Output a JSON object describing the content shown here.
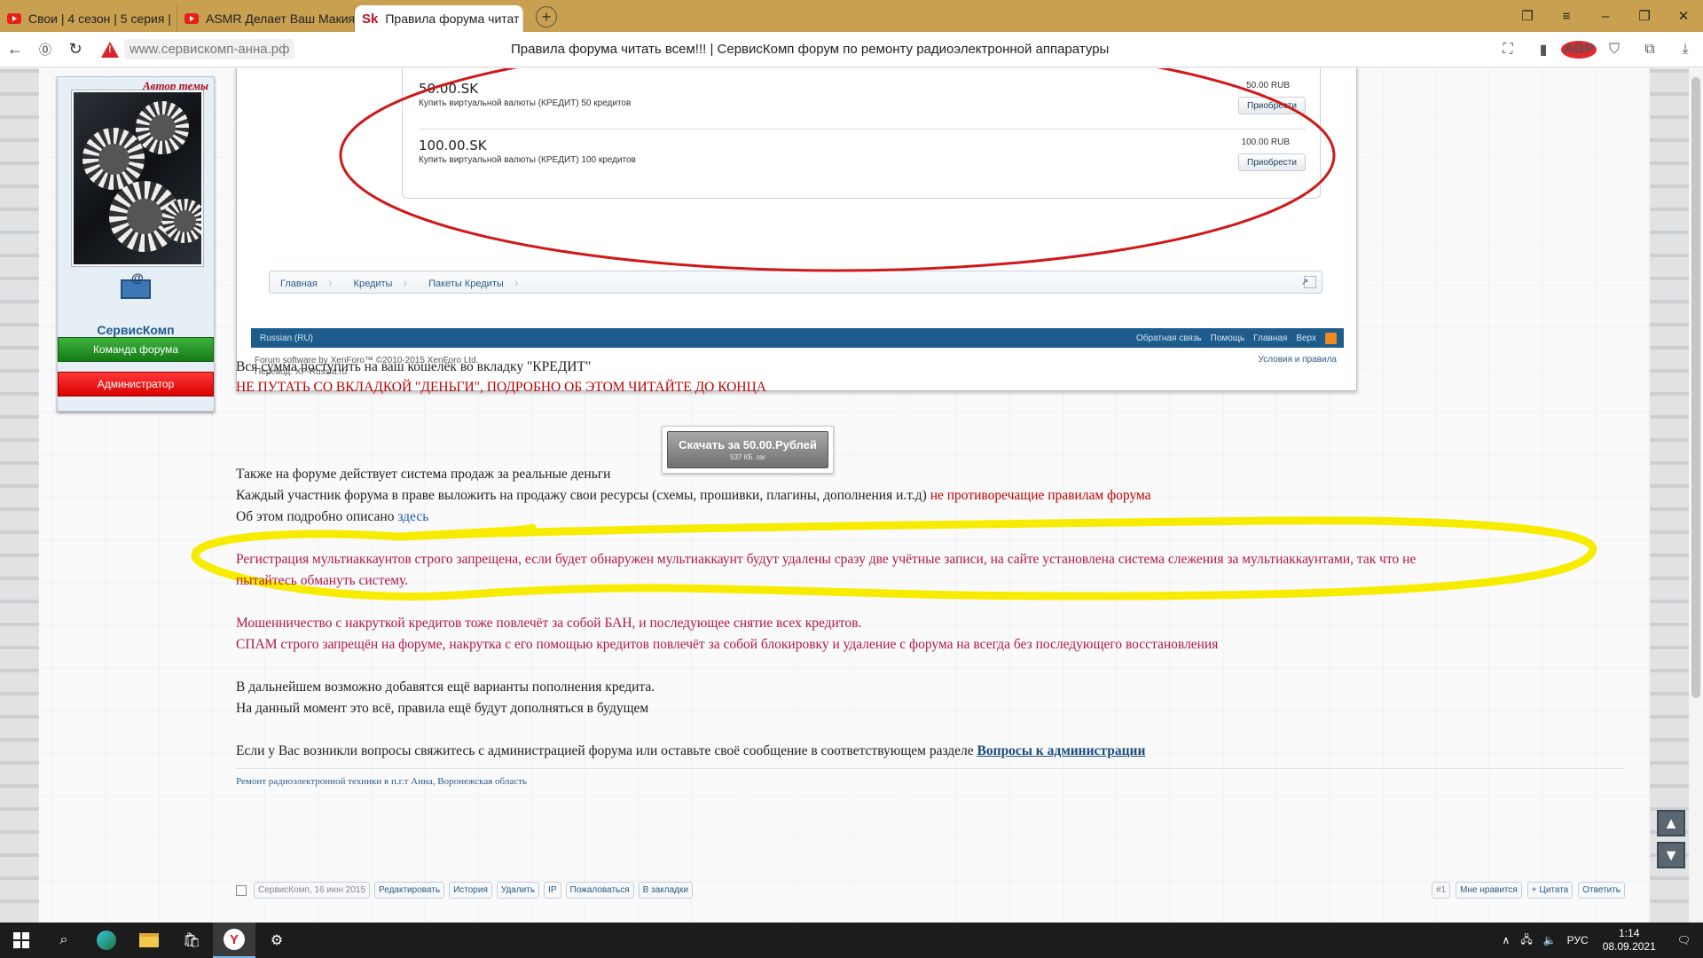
{
  "browser": {
    "tabs": [
      {
        "label": "Свои | 4 сезон | 5 серия |",
        "icon": "youtube-icon"
      },
      {
        "label": "ASMR Делает Ваш Макия",
        "icon": "youtube-icon"
      },
      {
        "label": "Правила форума читат",
        "icon": "sk-favicon",
        "favicon_text": "Sk"
      }
    ],
    "url": "www.сервискомп-анна.рф",
    "page_title": "Правила форума читать всем!!! | СервисКомп форум по ремонту радиоэлектронной аппаратуры",
    "adblock_label": "ABP",
    "extension_badge": "2"
  },
  "user_card": {
    "author_badge": "Автор темы",
    "username": "СервисКомп",
    "role_team": "Команда форума",
    "role_admin": "Администратор"
  },
  "screenshot": {
    "items": [
      {
        "name": "50.00.SK",
        "desc": "Купить виртуальной валюты (КРЕДИТ) 50 кредитов",
        "price": "50.00 RUB",
        "buy": "Приобрести"
      },
      {
        "name": "100.00.SK",
        "desc": "Купить виртуальной валюты (КРЕДИТ) 100 кредитов",
        "price": "100.00 RUB",
        "buy": "Приобрести"
      }
    ],
    "breadcrumbs": [
      "Главная",
      "Кредиты",
      "Пакеты Кредиты"
    ],
    "footer_lang": "Russian (RU)",
    "footer_links": [
      "Обратная связь",
      "Помощь",
      "Главная",
      "Верх"
    ],
    "copyright": "Forum software by XenForo™ ©2010-2015 XenForo Ltd.",
    "translation": "Перевод: XF-Russia.ru",
    "terms": "Условия и правила"
  },
  "post": {
    "line1": "Вся сумма поступить на ваш кошелёк во вкладку \"КРЕДИТ\"",
    "line2": "НЕ ПУТАТЬ СО ВКЛАДКОЙ \"ДЕНЬГИ\", ПОДРОБНО ОБ ЭТОМ ЧИТАЙТЕ ДО КОНЦА",
    "download_label": "Скачать за 50.00.Рублей",
    "download_size": "537 КБ .rar",
    "line3": "Также на форуме действует система продаж за реальные деньги",
    "line4": "Каждый участник форума в праве выложить на продажу свои ресурсы (схемы, прошивки, плагины, дополнения и.т.д)",
    "line4_red": "не противоречащие правилам форума",
    "line5": "Об этом подробно описано",
    "line5_link": "здесь",
    "line6": "Регистрация мультиаккаунтов строго запрещена, если будет обнаружен мультиаккаунт будут удалены сразу две учётные записи, на сайте установлена система слежения за мультиаккаунтами, так что не",
    "line6b": "пытайтесь обмануть систему.",
    "line7": "Мошенничество с накруткой кредитов тоже повлечёт за собой БАН, и последующее снятие всех кредитов.",
    "line8": "СПАМ строго запрещён на форуме, накрутка с его помощью кредитов повлечёт за собой блокировку и удаление с форума на всегда без последующего восстановления",
    "line9": "В дальнейшем возможно добавятся ещё варианты пополнения кредита.",
    "line10": "На данный момент это всё, правила ещё будут дополняться в будущем",
    "line11": "Если у Вас возникли вопросы свяжитесь с администрацией форума или оставьте своё сообщение в соответствующем разделе",
    "line11_link": "Вопросы к администрации",
    "signature": "Ремонт радиоэлектронной техники в п.г.т Анна, Воронежская область"
  },
  "post_actions": {
    "meta": "СервисКомп, 16 июн 2015",
    "left": [
      "Редактировать",
      "История",
      "Удалить",
      "IP",
      "Пожаловаться",
      "В закладки"
    ],
    "post_number": "#1",
    "right": [
      "Мне нравится",
      "+ Цитата",
      "Ответить"
    ]
  },
  "taskbar": {
    "lang": "РУС",
    "time": "1:14",
    "date": "08.09.2021"
  },
  "colors": {
    "tabbar": "#c8a050",
    "footer_blue": "#1e5c8c",
    "red_text": "#c00000",
    "magenta_text": "#b0164a",
    "ellipse_red": "#d01818",
    "highlight_yellow": "#f7ec00"
  }
}
